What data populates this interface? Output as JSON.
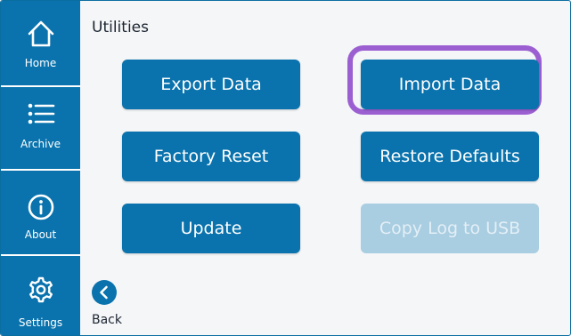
{
  "sidebar": {
    "items": [
      {
        "label": "Home",
        "icon": "home-icon"
      },
      {
        "label": "Archive",
        "icon": "list-icon"
      },
      {
        "label": "About",
        "icon": "info-icon"
      },
      {
        "label": "Settings",
        "icon": "gear-icon"
      }
    ]
  },
  "page": {
    "title": "Utilities"
  },
  "buttons": {
    "export": "Export Data",
    "import": "Import Data",
    "factory_reset": "Factory Reset",
    "restore_defaults": "Restore Defaults",
    "update": "Update",
    "copy_log": "Copy Log to USB"
  },
  "back": {
    "label": "Back",
    "icon": "chevron-left-icon"
  },
  "colors": {
    "primary": "#0a73ad",
    "disabled": "#a9cde1",
    "highlight": "#9b5fd1",
    "background": "#f4f6f8"
  }
}
